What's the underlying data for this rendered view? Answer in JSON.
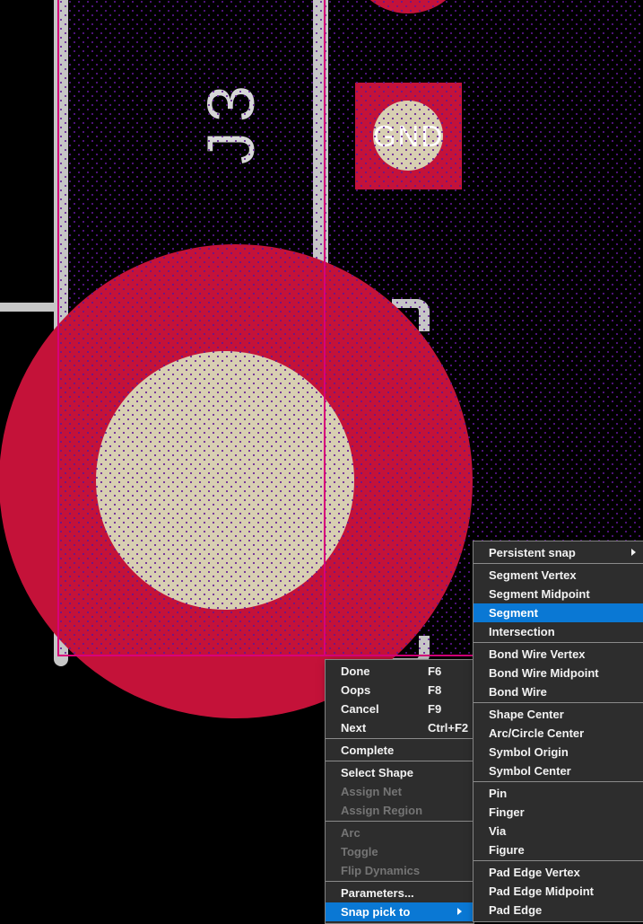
{
  "canvas": {
    "reference_designator": "J3",
    "pad_net_label": "GND",
    "colors": {
      "background": "#000000",
      "pad_copper": "#c41239",
      "drill_hole": "#d8cfb2",
      "outline_gray": "#c6c6c6",
      "shape_edge_magenta": "#d8007a",
      "fill_dot_purple": "#5f1696",
      "menu_background": "#2d2d2d",
      "menu_highlight_blue": "#0a78d4",
      "menu_text": "#f2f2f2",
      "menu_disabled_text": "#747474"
    }
  },
  "context_menu": {
    "items": [
      {
        "label": "Done",
        "shortcut": "F6",
        "state": "enabled"
      },
      {
        "label": "Oops",
        "shortcut": "F8",
        "state": "enabled"
      },
      {
        "label": "Cancel",
        "shortcut": "F9",
        "state": "enabled"
      },
      {
        "label": "Next",
        "shortcut": "Ctrl+F2",
        "state": "enabled"
      },
      {
        "type": "separator"
      },
      {
        "label": "Complete",
        "state": "enabled"
      },
      {
        "type": "separator"
      },
      {
        "label": "Select Shape",
        "state": "enabled"
      },
      {
        "label": "Assign Net",
        "state": "disabled"
      },
      {
        "label": "Assign Region",
        "state": "disabled"
      },
      {
        "type": "separator"
      },
      {
        "label": "Arc",
        "state": "disabled"
      },
      {
        "label": "Toggle",
        "state": "disabled"
      },
      {
        "label": "Flip Dynamics",
        "state": "disabled"
      },
      {
        "type": "separator"
      },
      {
        "label": "Parameters...",
        "state": "enabled"
      },
      {
        "label": "Snap pick to",
        "state": "highlighted",
        "submenu_arrow": true
      }
    ]
  },
  "snap_submenu": {
    "items": [
      {
        "label": "Persistent snap",
        "state": "enabled",
        "submenu_arrow": true
      },
      {
        "type": "separator"
      },
      {
        "label": "Segment Vertex",
        "state": "enabled"
      },
      {
        "label": "Segment Midpoint",
        "state": "enabled"
      },
      {
        "label": "Segment",
        "state": "highlighted"
      },
      {
        "label": "Intersection",
        "state": "enabled"
      },
      {
        "type": "separator"
      },
      {
        "label": "Bond Wire Vertex",
        "state": "enabled"
      },
      {
        "label": "Bond Wire Midpoint",
        "state": "enabled"
      },
      {
        "label": "Bond Wire",
        "state": "enabled"
      },
      {
        "type": "separator"
      },
      {
        "label": "Shape Center",
        "state": "enabled"
      },
      {
        "label": "Arc/Circle Center",
        "state": "enabled"
      },
      {
        "label": "Symbol Origin",
        "state": "enabled"
      },
      {
        "label": "Symbol Center",
        "state": "enabled"
      },
      {
        "type": "separator"
      },
      {
        "label": "Pin",
        "state": "enabled"
      },
      {
        "label": "Finger",
        "state": "enabled"
      },
      {
        "label": "Via",
        "state": "enabled"
      },
      {
        "label": "Figure",
        "state": "enabled"
      },
      {
        "type": "separator"
      },
      {
        "label": "Pad Edge Vertex",
        "state": "enabled"
      },
      {
        "label": "Pad Edge Midpoint",
        "state": "enabled"
      },
      {
        "label": "Pad Edge",
        "state": "enabled"
      }
    ]
  }
}
